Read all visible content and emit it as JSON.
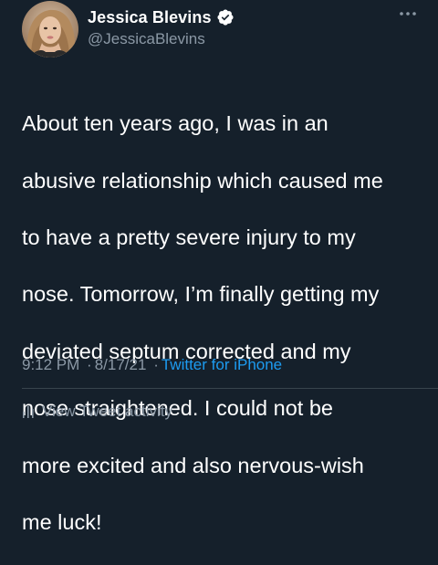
{
  "user": {
    "display_name": "Jessica Blevins",
    "handle": "@JessicaBlevins",
    "verified": true,
    "avatar_icon": "profile-photo"
  },
  "tweet": {
    "text_lines": [
      "About ten years ago, I was in an",
      "abusive relationship which caused me",
      "to have a pretty severe injury to my",
      "nose. Tomorrow, I’m finally getting my",
      "deviated septum corrected and my",
      "nose straightened. I could not be",
      "more excited and also nervous-wish",
      "me luck!"
    ],
    "time": "9:12 PM",
    "separator": "·",
    "date": "8/17/21",
    "source": "Twitter for iPhone"
  },
  "actions": {
    "activity_label": "View Tweet activity",
    "more_icon": "more-options-icon"
  },
  "colors": {
    "background": "#15202b",
    "primary_text": "#ffffff",
    "secondary_text": "#8b98a5",
    "accent": "#1d9bf0",
    "divider": "#38444d"
  }
}
